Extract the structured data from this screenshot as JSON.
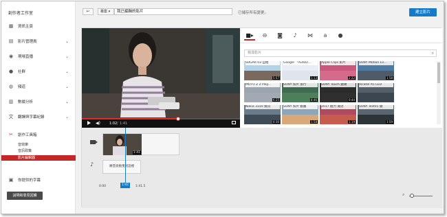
{
  "sidebar": {
    "title": "創作者工作室",
    "items": [
      {
        "label": "資訊主頁",
        "icon": "dashboard-icon",
        "chevron": false
      },
      {
        "label": "影片管理員",
        "icon": "video-manager-icon",
        "chevron": true
      },
      {
        "label": "現場直播",
        "icon": "live-icon",
        "chevron": true
      },
      {
        "label": "社群",
        "icon": "community-icon",
        "chevron": true
      },
      {
        "label": "頻道",
        "icon": "channel-icon",
        "chevron": true
      },
      {
        "label": "數據分析",
        "icon": "analytics-icon",
        "chevron": true
      },
      {
        "label": "翻譯與字幕紀錄",
        "icon": "translate-icon",
        "chevron": true
      },
      {
        "label": "創作工具箱",
        "icon": "create-tools-icon",
        "chevron": false,
        "accent": true
      }
    ],
    "subitems": [
      {
        "label": "音效庫",
        "active": false
      },
      {
        "label": "音訊政策",
        "active": false
      },
      {
        "label": "影片編輯器",
        "active": true
      }
    ],
    "contributed_subtitles": "你提供的字幕",
    "feedback_button": "說明和意見回饋"
  },
  "topbar": {
    "back_icon": "↩",
    "visibility": "專案",
    "title_value": "我已編輯的影片",
    "saved_status": "已儲存所有變更。",
    "create_button": "建立影片"
  },
  "player": {
    "current_time": "1:02",
    "separator": "/",
    "total_time": "1:41",
    "progress": 0.61
  },
  "media": {
    "tabs": [
      "video-camera-icon",
      "cc-icon",
      "photo-icon",
      "music-icon",
      "transition-icon",
      "text-icon",
      "help-icon"
    ],
    "search_placeholder": "我尋影片",
    "thumbs": [
      {
        "title": "SUGAR 03 自拍",
        "duration": "",
        "color": "#b5d3e6"
      },
      {
        "title": "Google 「AutoD...",
        "duration": "",
        "color": "#e9eef4"
      },
      {
        "title": "Apple Clips 影片",
        "duration": "",
        "color": "#c9577e"
      },
      {
        "title": "SONY Motion Ev...",
        "duration": "",
        "color": "#4e7aa3"
      },
      {
        "title": "",
        "duration": "5:57",
        "color": "#7a6a5e"
      },
      {
        "title": "",
        "duration": "1:13",
        "color": "#dfe5ec"
      },
      {
        "title": "",
        "duration": "2:22",
        "color": "#d56a8a"
      },
      {
        "title": "",
        "duration": "1:58",
        "color": "#4f5b68"
      },
      {
        "title": "MOTO Z 2 Play...",
        "duration": "",
        "color": "#9aa5b0"
      },
      {
        "title": "SONY 照片 旅行",
        "duration": "",
        "color": "#3e6b52"
      },
      {
        "title": "SONY Touch 鏡頭",
        "duration": "",
        "color": "#2c2c2c"
      },
      {
        "title": "Alcatel A5 LED",
        "duration": "",
        "color": "#555f6a"
      },
      {
        "title": "",
        "duration": "6:25",
        "color": "#a3a9b2"
      },
      {
        "title": "",
        "duration": "8:46",
        "color": "#4e7f5b"
      },
      {
        "title": "",
        "duration": "0:44",
        "color": "#2f2f2f"
      },
      {
        "title": "",
        "duration": "",
        "color": "#3c4650"
      },
      {
        "title": "Nokia 3310 資訊",
        "duration": "",
        "color": "#6a7c8b"
      },
      {
        "title": "SONY 照片 動畫",
        "duration": "",
        "color": "#8fa6ba"
      },
      {
        "title": "2017 魅力 潮流",
        "duration": "",
        "color": "#b04a5e"
      },
      {
        "title": "SONY Test01 變",
        "duration": "",
        "color": "#5c6670"
      },
      {
        "title": "",
        "duration": "0:30",
        "color": "#3f4c57"
      },
      {
        "title": "",
        "duration": "1:58",
        "color": "#d9a87a"
      },
      {
        "title": "",
        "duration": "1:19",
        "color": "#c75b4e"
      },
      {
        "title": "",
        "duration": "1:59",
        "color": "#2d3438"
      }
    ]
  },
  "timeline": {
    "clip_duration": "1:41",
    "audio_label": "將音訊拖曳到這裡",
    "playhead_time": "1:02",
    "start_time": "0:00",
    "end_time": "1:41.5"
  }
}
